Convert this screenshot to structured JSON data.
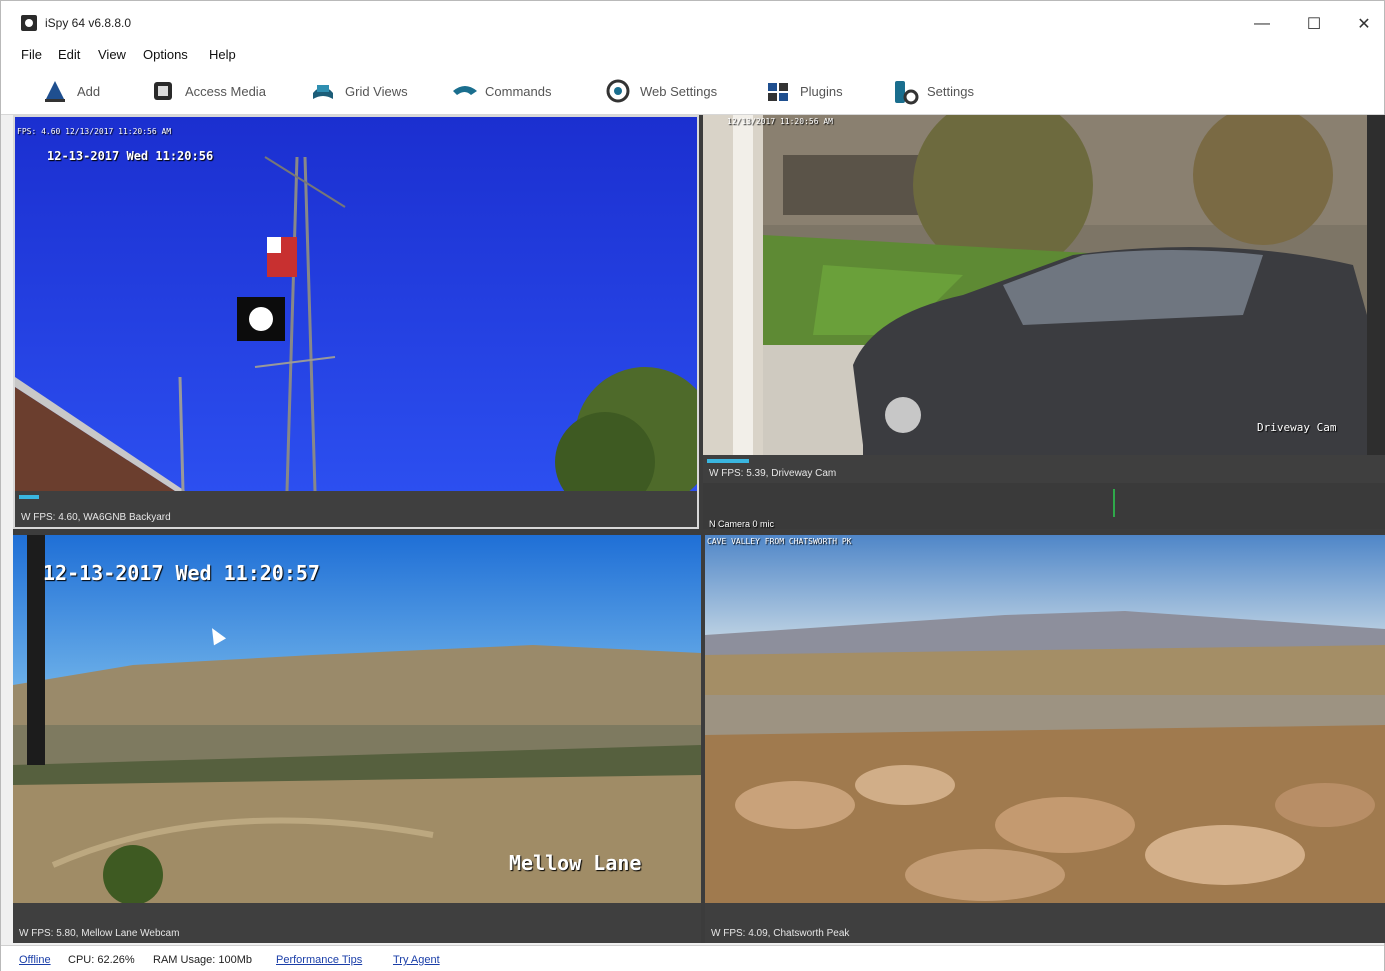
{
  "window": {
    "title": "iSpy 64 v6.8.8.0"
  },
  "menu": [
    "File",
    "Edit",
    "View",
    "Options",
    "Help"
  ],
  "toolbar": [
    {
      "label": "Add",
      "icon": "add-icon"
    },
    {
      "label": "Access Media",
      "icon": "access-media-icon"
    },
    {
      "label": "Grid Views",
      "icon": "grid-views-icon"
    },
    {
      "label": "Commands",
      "icon": "commands-icon"
    },
    {
      "label": "Web Settings",
      "icon": "web-settings-icon"
    },
    {
      "label": "Plugins",
      "icon": "plugins-icon"
    },
    {
      "label": "Settings",
      "icon": "settings-icon"
    }
  ],
  "cameras": [
    {
      "name": "WA6GNB Backyard",
      "status": "W FPS: 4.60, WA6GNB Backyard",
      "top_overlay": "FPS: 4.60 12/13/2017 11:20:56 AM",
      "timestamp": "12-13-2017 Wed 11:20:56"
    },
    {
      "name": "Driveway Cam",
      "status": "W FPS: 5.39, Driveway Cam",
      "top_overlay": "12/13/2017 11:20:56 AM",
      "watermark": "Driveway Cam",
      "extra_status": "N Camera 0 mic"
    },
    {
      "name": "Mellow Lane Webcam",
      "status": "W FPS: 5.80, Mellow Lane Webcam",
      "timestamp": "12-13-2017 Wed 11:20:57",
      "watermark": "Mellow Lane"
    },
    {
      "name": "Chatsworth Peak",
      "status": "W FPS: 4.09, Chatsworth Peak",
      "top_overlay": "CAVE VALLEY FROM CHATSWORTH PK"
    }
  ],
  "status": {
    "connection": "Offline",
    "cpu": "CPU: 62.26%",
    "ram": "RAM Usage: 100Mb",
    "tips": "Performance Tips",
    "agent": "Try Agent"
  },
  "colors": {
    "accent": "#3ab6e0",
    "panel": "#3f3f3f"
  }
}
